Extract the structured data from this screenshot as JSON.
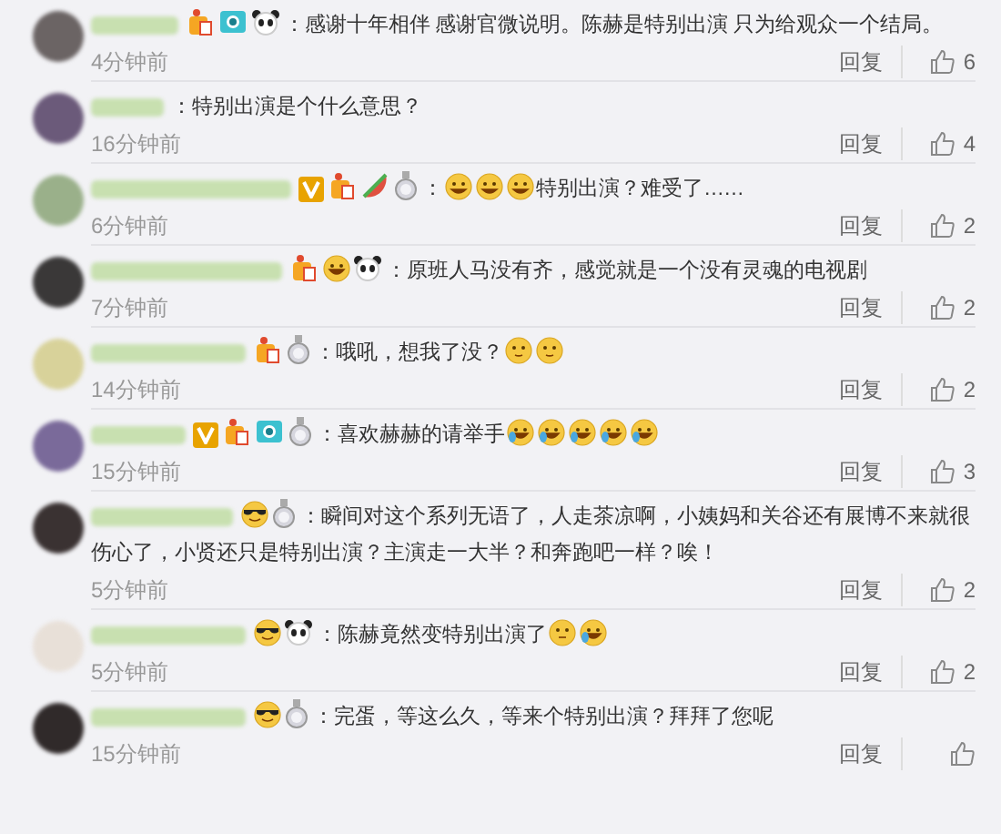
{
  "comments": [
    {
      "badges": [
        {
          "kind": "fan"
        },
        {
          "kind": "camera"
        },
        {
          "kind": "panda"
        }
      ],
      "content": [
        {
          "kind": "text",
          "text": "：感谢十年相伴 感谢官微说明。陈赫是特别出演 只为给观众一个结局。"
        }
      ],
      "time": "4分钟前",
      "reply": "回复",
      "likes": "6"
    },
    {
      "content": [
        {
          "kind": "text",
          "text": "：特别出演是个什么意思？"
        }
      ],
      "time": "16分钟前",
      "reply": "回复",
      "likes": "4"
    },
    {
      "badges": [
        {
          "kind": "vip"
        },
        {
          "kind": "fan"
        },
        {
          "kind": "melon"
        },
        {
          "kind": "medal"
        }
      ],
      "content": [
        {
          "kind": "text",
          "text": "："
        },
        {
          "kind": "grin"
        },
        {
          "kind": "grin"
        },
        {
          "kind": "grin"
        },
        {
          "kind": "text",
          "text": "特别出演？难受了……"
        }
      ],
      "time": "6分钟前",
      "reply": "回复",
      "likes": "2"
    },
    {
      "badges": [
        {
          "kind": "fan"
        },
        {
          "kind": "smile"
        },
        {
          "kind": "panda"
        }
      ],
      "content": [
        {
          "kind": "text",
          "text": "：原班人马没有齐，感觉就是一个没有灵魂的电视剧"
        }
      ],
      "time": "7分钟前",
      "reply": "回复",
      "likes": "2"
    },
    {
      "badges": [
        {
          "kind": "fan"
        },
        {
          "kind": "medal"
        }
      ],
      "content": [
        {
          "kind": "text",
          "text": "：哦吼，想我了没？"
        },
        {
          "kind": "cat"
        },
        {
          "kind": "cat"
        }
      ],
      "time": "14分钟前",
      "reply": "回复",
      "likes": "2"
    },
    {
      "badges": [
        {
          "kind": "vip"
        },
        {
          "kind": "fan"
        },
        {
          "kind": "camera"
        },
        {
          "kind": "medal"
        }
      ],
      "content": [
        {
          "kind": "text",
          "text": "：喜欢赫赫的请举手"
        },
        {
          "kind": "cry"
        },
        {
          "kind": "cry"
        },
        {
          "kind": "cry"
        },
        {
          "kind": "cry"
        },
        {
          "kind": "cry"
        }
      ],
      "time": "15分钟前",
      "reply": "回复",
      "likes": "3"
    },
    {
      "badges": [
        {
          "kind": "cool"
        },
        {
          "kind": "medal"
        }
      ],
      "content": [
        {
          "kind": "text",
          "text": "：瞬间对这个系列无语了，人走茶凉啊，小姨妈和关谷还有展博不来就很"
        },
        {
          "kind": "line",
          "text": "伤心了，小贤还只是特别出演？主演走一大半？和奔跑吧一样？唉！"
        }
      ],
      "time": "5分钟前",
      "reply": "回复",
      "likes": "2"
    },
    {
      "badges": [
        {
          "kind": "cool"
        },
        {
          "kind": "panda"
        }
      ],
      "content": [
        {
          "kind": "text",
          "text": "：陈赫竟然变特别出演了"
        },
        {
          "kind": "shrug"
        },
        {
          "kind": "cry"
        }
      ],
      "time": "5分钟前",
      "reply": "回复",
      "likes": "2"
    },
    {
      "badges": [
        {
          "kind": "cool"
        },
        {
          "kind": "medal"
        }
      ],
      "content": [
        {
          "kind": "text",
          "text": "：完蛋，等这么久，等来个特别出演？拜拜了您呢"
        }
      ],
      "time": "15分钟前",
      "reply": "回复"
    }
  ]
}
